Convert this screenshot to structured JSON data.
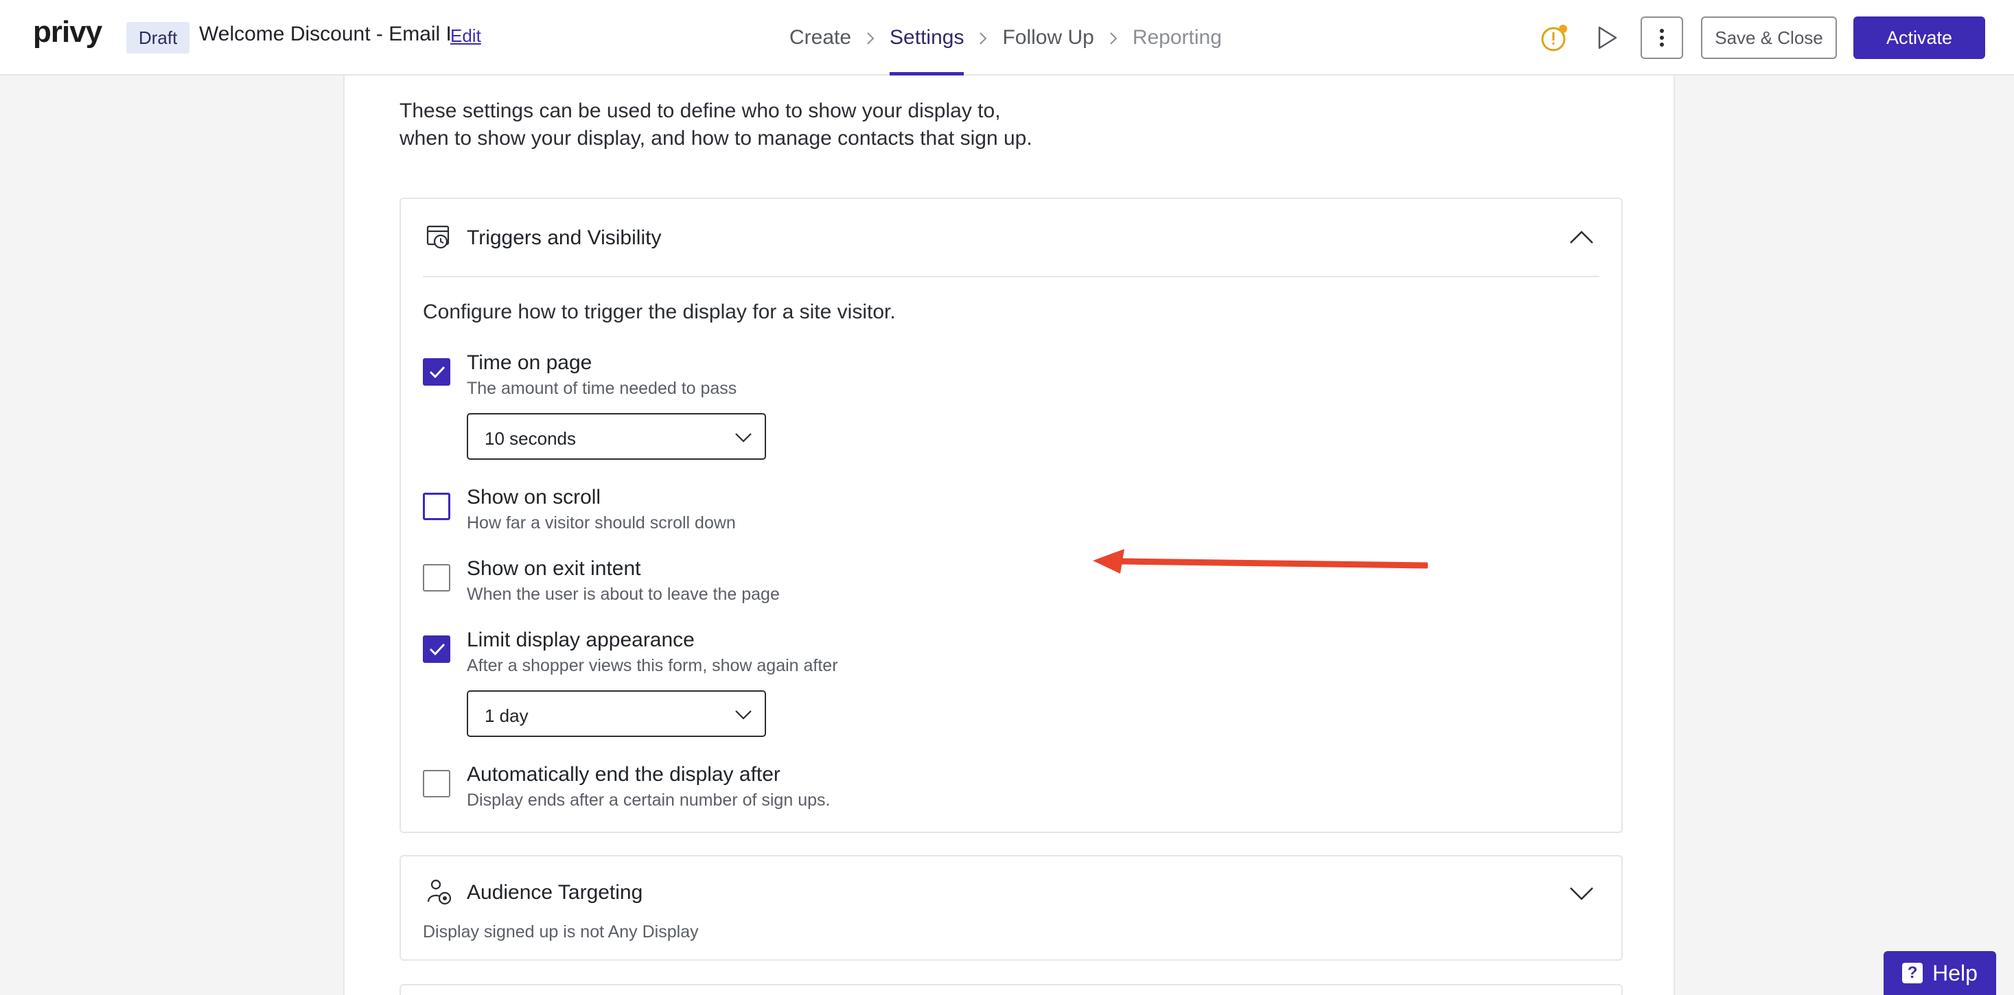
{
  "header": {
    "logo": "privy",
    "status_badge": "Draft",
    "title": "Welcome Discount - Email I",
    "edit_label": "Edit",
    "steps": [
      {
        "label": "Create",
        "state": "default"
      },
      {
        "label": "Settings",
        "state": "active"
      },
      {
        "label": "Follow Up",
        "state": "default"
      },
      {
        "label": "Reporting",
        "state": "muted"
      }
    ],
    "save_close_label": "Save & Close",
    "activate_label": "Activate",
    "icons": [
      "alert-icon",
      "play-icon",
      "more-vertical-icon"
    ]
  },
  "main": {
    "intro_line1": "These settings can be used to define who to show your display to,",
    "intro_line2": "when to show your display, and how to manage contacts that sign up.",
    "triggers": {
      "title": "Triggers and Visibility",
      "expanded": true,
      "description": "Configure how to trigger the display for a site visitor.",
      "options": [
        {
          "title": "Time on page",
          "description": "The amount of time needed to pass",
          "checked": true,
          "select_value": "10 seconds"
        },
        {
          "title": "Show on scroll",
          "description": "How far a visitor should scroll down",
          "checked": false
        },
        {
          "title": "Show on exit intent",
          "description": "When the user is about to leave the page",
          "checked": false
        },
        {
          "title": "Limit display appearance",
          "description": "After a shopper views this form, show again after",
          "checked": true,
          "select_value": "1 day"
        },
        {
          "title": "Automatically end the display after",
          "description": "Display ends after a certain number of sign ups.",
          "checked": false
        }
      ]
    },
    "audience": {
      "title": "Audience Targeting",
      "expanded": false,
      "summary": "Display signed up is not Any Display"
    }
  },
  "help": {
    "label": "Help"
  },
  "colors": {
    "accent": "#3d2ab5",
    "annotation_arrow": "#e8452c",
    "alert": "#d9a514"
  }
}
